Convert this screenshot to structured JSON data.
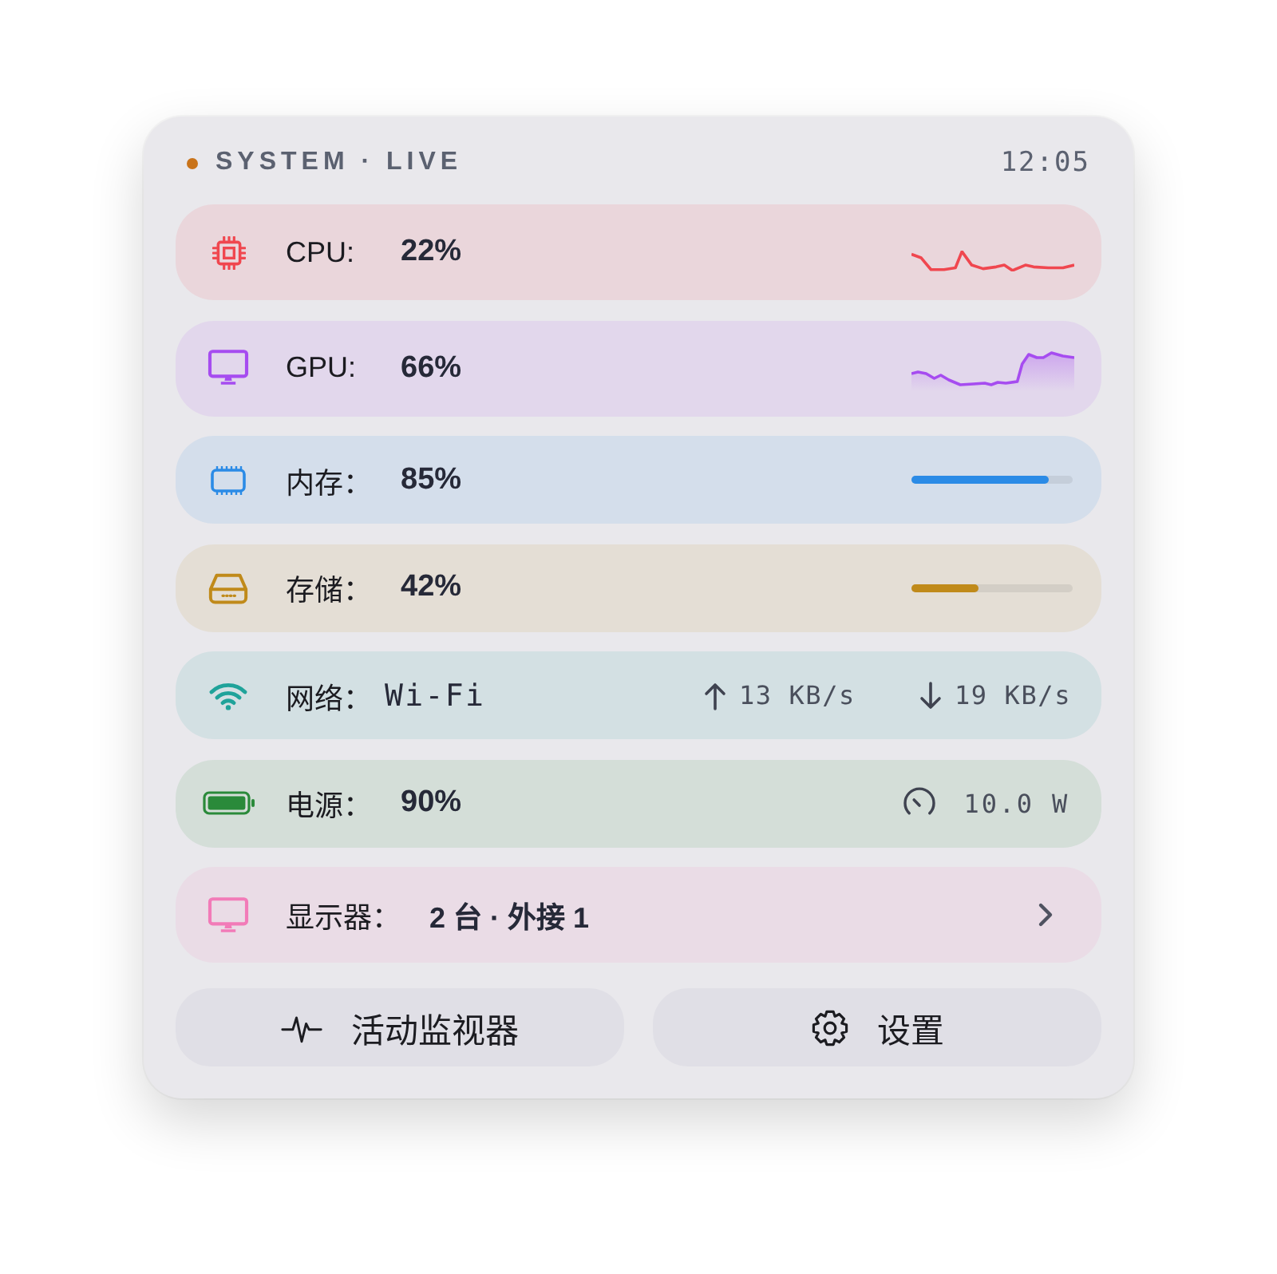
{
  "header": {
    "title": "SYSTEM · LIVE",
    "time": "12:05"
  },
  "rows": [
    {
      "kind": "cpu",
      "label": "CPU:",
      "value": "22%",
      "color": "#f0474f"
    },
    {
      "kind": "gpu",
      "label": "GPU:",
      "value": "66%",
      "color": "#a64cf0"
    },
    {
      "kind": "memory",
      "label": "内存：",
      "value": "85%",
      "level": 0.85,
      "color": "#2b8be6"
    },
    {
      "kind": "storage",
      "label": "存储：",
      "value": "42%",
      "level": 0.42,
      "color": "#c08a1a"
    },
    {
      "kind": "network",
      "label": "网络：",
      "value": "Wi-Fi",
      "upload": "13 KB/s",
      "download": "19 KB/s",
      "color": "#1fa39a"
    },
    {
      "kind": "power",
      "label": "电源：",
      "value": "90%",
      "draw": "10.0 W",
      "color": "#2a8a3a"
    },
    {
      "kind": "display",
      "label": "显示器：",
      "value": "2 台 · 外接 1",
      "color": "#f27bb8"
    }
  ],
  "buttons": [
    {
      "kind": "activity",
      "label": "活动监视器"
    },
    {
      "kind": "settings",
      "label": "设置"
    }
  ]
}
